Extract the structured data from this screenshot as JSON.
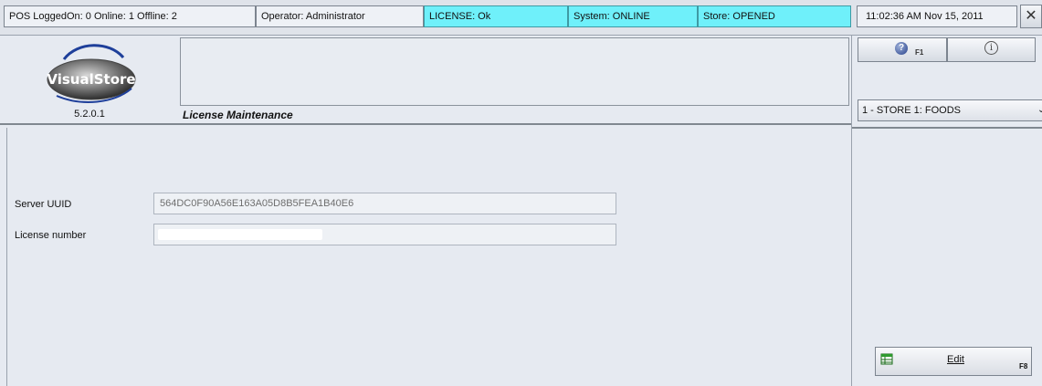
{
  "status": {
    "pos": "POS LoggedOn: 0  Online: 1  Offline: 2",
    "operator": "Operator:  Administrator",
    "license": "LICENSE: Ok",
    "system": "System: ONLINE",
    "store": "Store: OPENED",
    "datetime": "11:02:36 AM   Nov 15, 2011",
    "close_glyph": "✕"
  },
  "header": {
    "logo_text": "VisualStore",
    "version": "5.2.0.1",
    "title": "License Maintenance"
  },
  "rightpanel": {
    "help_key": "F1",
    "help_glyph": "?",
    "info_glyph": "i",
    "store_selected": "1 - STORE 1: FOODS",
    "store_arrow": "⌄",
    "edit_label": "Edit",
    "edit_key": "F8"
  },
  "form": {
    "server_uuid_label": "Server UUID",
    "server_uuid_value": "564DC0F90A56E163A05D8B5FEA1B40E6",
    "license_number_label": "License number",
    "license_number_value": ""
  },
  "colors": {
    "highlight_cyan": "#6ff0fa",
    "background": "#e6eaf1"
  },
  "icons": {
    "help": "help-question-icon",
    "info": "info-icon",
    "edit": "edit-sheet-icon",
    "close": "close-icon",
    "dropdown": "chevron-down-icon"
  }
}
